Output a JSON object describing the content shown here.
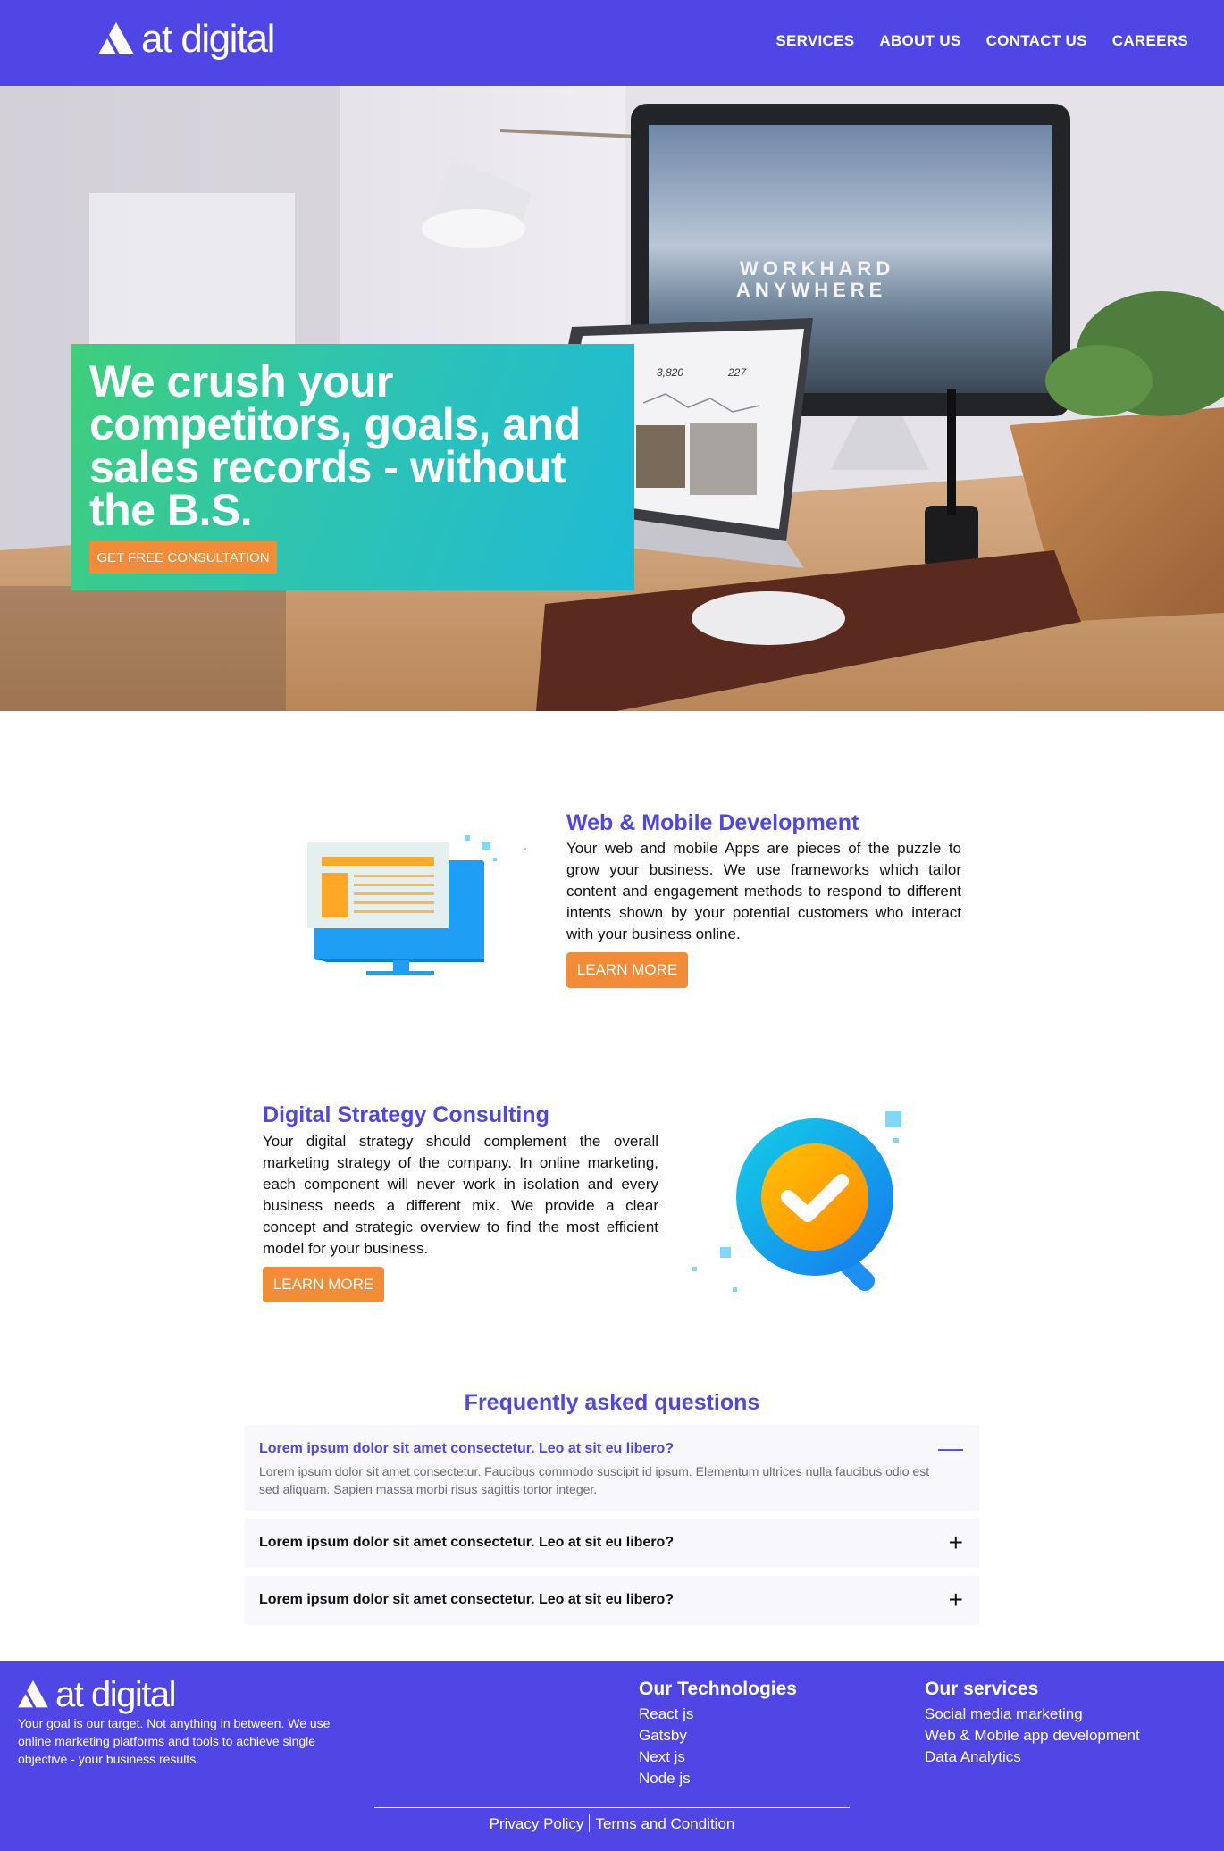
{
  "header": {
    "logo_text": "at digital",
    "nav": [
      "SERVICES",
      "ABOUT US",
      "CONTACT US",
      "CAREERS"
    ]
  },
  "hero": {
    "title": "We crush your competitors, goals, and sales records - without the B.S.",
    "cta": "GET FREE CONSULTATION",
    "monitor_text_1": "WORKHARD",
    "monitor_text_2": "ANYWHERE",
    "laptop_stat_1": "3,820",
    "laptop_stat_2": "227"
  },
  "services": [
    {
      "title": "Web & Mobile Development",
      "text": "Your web and mobile Apps are pieces of the puzzle to grow your business. We use frameworks which tailor content and engagement methods to respond to different intents shown by your potential customers who interact with your business online.",
      "button": "LEARN MORE",
      "icon": "monitor-icon"
    },
    {
      "title": "Digital Strategy Consulting",
      "text": "Your digital strategy should complement the overall marketing strategy of the company. In online marketing, each component will never work in isolation and every business needs a different mix. We provide a clear concept and strategic overview to find the most efficient model for your business.",
      "button": "LEARN MORE",
      "icon": "magnifier-check-icon"
    }
  ],
  "faq": {
    "heading": "Frequently asked questions",
    "items": [
      {
        "question": "Lorem ipsum dolor sit amet consectetur. Leo at sit eu libero?",
        "answer": "Lorem ipsum dolor sit amet consectetur. Faucibus commodo suscipit id ipsum. Elementum ultrices nulla faucibus odio est sed aliquam. Sapien massa morbi risus sagittis tortor integer.",
        "toggle": "—"
      },
      {
        "question": "Lorem ipsum dolor sit amet consectetur. Leo at sit eu libero?",
        "toggle": "+"
      },
      {
        "question": "Lorem ipsum dolor sit amet consectetur. Leo at sit eu libero?",
        "toggle": "+"
      }
    ]
  },
  "footer": {
    "logo_text": "at digital",
    "tagline": "Your goal is our target. Not anything in between. We use online marketing platforms and tools to achieve single objective - your business results.",
    "technologies": {
      "title": "Our Technologies",
      "items": [
        "React js",
        "Gatsby",
        "Next js",
        "Node js"
      ]
    },
    "services": {
      "title": "Our services",
      "items": [
        "Social media marketing",
        "Web & Mobile app development",
        "Data Analytics"
      ]
    },
    "privacy": "Privacy Policy",
    "terms": "Terms and Condition"
  },
  "colors": {
    "brand": "#4f46e5",
    "accent": "#f28c38",
    "hero_gradient_start": "#3ecf7a",
    "hero_gradient_end": "#1fbad6"
  }
}
